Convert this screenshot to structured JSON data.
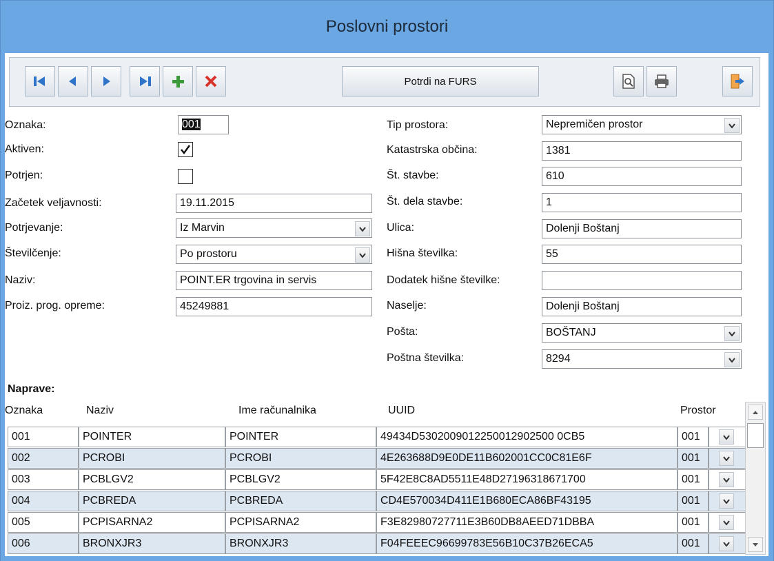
{
  "window": {
    "title": "Poslovni prostori"
  },
  "toolbar": {
    "confirm_label": "Potrdi na FURS",
    "icons": [
      "first-record-icon",
      "previous-record-icon",
      "next-record-icon",
      "last-record-icon",
      "add-icon",
      "delete-icon",
      "print-preview-icon",
      "print-icon",
      "exit-icon"
    ]
  },
  "left_form": {
    "oznaka": {
      "label": "Oznaka:",
      "value": "001"
    },
    "aktiven": {
      "label": "Aktiven:",
      "checked": true
    },
    "potrjen": {
      "label": "Potrjen:",
      "checked": false
    },
    "zacetek": {
      "label": "Začetek veljavnosti:",
      "value": "19.11.2015"
    },
    "potrjevanje": {
      "label": "Potrjevanje:",
      "value": "Iz Marvin"
    },
    "stevilcenje": {
      "label": "Številčenje:",
      "value": "Po prostoru"
    },
    "naziv": {
      "label": "Naziv:",
      "value": "POINT.ER trgovina in servis"
    },
    "proiz": {
      "label": "Proiz. prog. opreme:",
      "value": "45249881"
    }
  },
  "right_form": {
    "tip": {
      "label": "Tip prostora:",
      "value": "Nepremičen prostor"
    },
    "katastrska": {
      "label": "Katastrska občina:",
      "value": "1381"
    },
    "st_stavbe": {
      "label": "Št. stavbe:",
      "value": "610"
    },
    "st_dela": {
      "label": "Št. dela stavbe:",
      "value": "1"
    },
    "ulica": {
      "label": "Ulica:",
      "value": "Dolenji Boštanj"
    },
    "hisna": {
      "label": "Hišna številka:",
      "value": "55"
    },
    "dodatek": {
      "label": "Dodatek hišne številke:",
      "value": ""
    },
    "naselje": {
      "label": "Naselje:",
      "value": "Dolenji Boštanj"
    },
    "posta": {
      "label": "Pošta:",
      "value": "BOŠTANJ"
    },
    "postna": {
      "label": "Poštna številka:",
      "value": "8294"
    }
  },
  "devices": {
    "title": "Naprave:",
    "columns": [
      "Oznaka",
      "Naziv",
      "Ime računalnika",
      "UUID",
      "Prostor"
    ],
    "rows": [
      {
        "oznaka": "001",
        "naziv": "POINTER",
        "ime": "POINTER",
        "uuid": "49434D5302009012250012902500 0CB5",
        "prostor": "001"
      },
      {
        "oznaka": "002",
        "naziv": "PCROBI",
        "ime": "PCROBI",
        "uuid": "4E263688D9E0DE11B602001CC0C81E6F",
        "prostor": "001"
      },
      {
        "oznaka": "003",
        "naziv": "PCBLGV2",
        "ime": "PCBLGV2",
        "uuid": "5F42E8C8AD5511E48D27196318671700",
        "prostor": "001"
      },
      {
        "oznaka": "004",
        "naziv": "PCBREDA",
        "ime": "PCBREDA",
        "uuid": "CD4E570034D411E1B680ECA86BF43195",
        "prostor": "001"
      },
      {
        "oznaka": "005",
        "naziv": "PCPISARNA2",
        "ime": "PCPISARNA2",
        "uuid": "F3E82980727711E3B60DB8AEED71DBBA",
        "prostor": "001"
      },
      {
        "oznaka": "006",
        "naziv": "BRONXJR3",
        "ime": "BRONXJR3",
        "uuid": "F04FEEEC96699783E56B10C37B26ECA5",
        "prostor": "001"
      }
    ]
  },
  "colors": {
    "frame": "#6aa7e3",
    "alt_row": "#dde7f2",
    "add": "#3a9a3a",
    "delete": "#d9342b"
  }
}
